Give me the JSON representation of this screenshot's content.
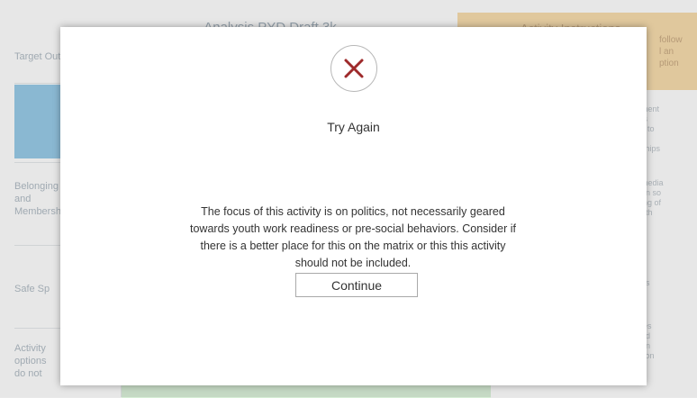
{
  "background": {
    "matrix_title": "Analysis PYD Draft 3k",
    "instructions_header": "Activity Instructions",
    "instructions_snippet": [
      "follow",
      "l an",
      "ption"
    ],
    "row_labels": {
      "target_outcome": "Target Outcome",
      "pyd_cell": "PY",
      "belonging": "Belonging and Membership",
      "safe_space": "Safe Sp",
      "activity_options": "Activity options do not"
    },
    "right_snippets": [
      "ment",
      "ts",
      "s to",
      "d",
      "ships",
      "media",
      "on so",
      "ing of",
      "uth",
      "h",
      "h",
      "es",
      "e",
      "ies",
      "ed",
      "on",
      "tion"
    ]
  },
  "modal": {
    "icon": "x-icon",
    "icon_color": "#9e2a2b",
    "title": "Try Again",
    "feedback_lines": [
      "The focus of this activity is on politics, not necessarily geared",
      "towards youth work readiness or pre-social behaviors. Consider if",
      "there is a better place for this on the matrix or this this activity",
      "should not be included."
    ],
    "continue_label": "Continue"
  }
}
